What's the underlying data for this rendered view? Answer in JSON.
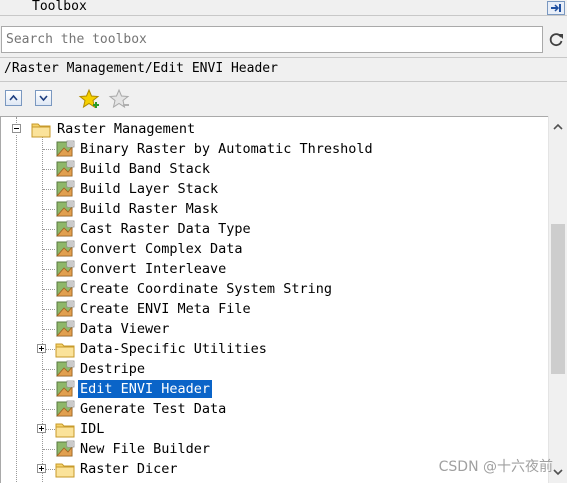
{
  "window": {
    "title": "Toolbox"
  },
  "search": {
    "placeholder": "Search the toolbox",
    "value": ""
  },
  "path": {
    "text": "/Raster Management/Edit ENVI Header"
  },
  "toolbar": {
    "expand_icon": "expand-all-icon",
    "collapse_icon": "collapse-all-icon",
    "add_favorite_icon": "add-favorite-star-icon",
    "remove_favorite_icon": "remove-favorite-star-icon"
  },
  "tree": {
    "root": {
      "label": "Raster Management",
      "expanded": true
    },
    "items": [
      {
        "label": "Binary Raster by Automatic Threshold",
        "type": "tool"
      },
      {
        "label": "Build Band Stack",
        "type": "tool"
      },
      {
        "label": "Build Layer Stack",
        "type": "tool"
      },
      {
        "label": "Build Raster Mask",
        "type": "tool"
      },
      {
        "label": "Cast Raster Data Type",
        "type": "tool"
      },
      {
        "label": "Convert Complex Data",
        "type": "tool"
      },
      {
        "label": "Convert Interleave",
        "type": "tool"
      },
      {
        "label": "Create Coordinate System String",
        "type": "tool"
      },
      {
        "label": "Create ENVI Meta File",
        "type": "tool"
      },
      {
        "label": "Data Viewer",
        "type": "tool"
      },
      {
        "label": "Data-Specific Utilities",
        "type": "folder"
      },
      {
        "label": "Destripe",
        "type": "tool"
      },
      {
        "label": "Edit ENVI Header",
        "type": "tool",
        "selected": true
      },
      {
        "label": "Generate Test Data",
        "type": "tool"
      },
      {
        "label": "IDL",
        "type": "folder"
      },
      {
        "label": "New File Builder",
        "type": "tool"
      },
      {
        "label": "Raster Dicer",
        "type": "folder"
      }
    ]
  },
  "colors": {
    "selection": "#0a64c8",
    "folder": "#f5d36b",
    "tool": "#e0a050"
  },
  "watermark": "CSDN @十六夜前"
}
